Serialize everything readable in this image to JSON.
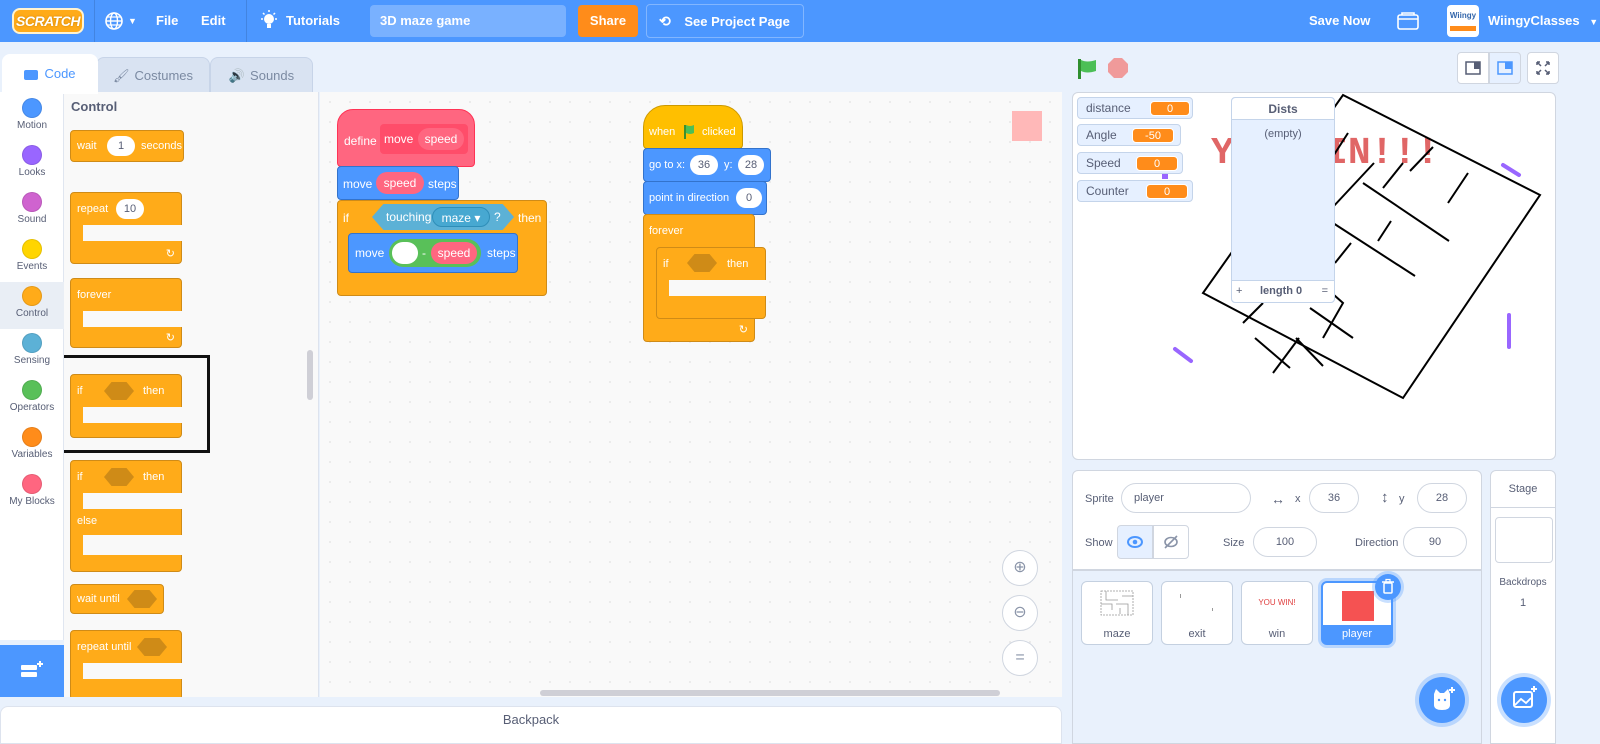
{
  "menubar": {
    "logo": "SCRATCH",
    "file": "File",
    "edit": "Edit",
    "tutorials": "Tutorials",
    "project_title": "3D maze game",
    "share": "Share",
    "see_project_page": "See Project Page",
    "save_now": "Save Now",
    "username": "WiingyClasses",
    "avatar_text": "Wiingy",
    "brand_color": "#4c97ff"
  },
  "tabs": [
    {
      "label": "Code",
      "active": true
    },
    {
      "label": "Costumes",
      "active": false
    },
    {
      "label": "Sounds",
      "active": false
    }
  ],
  "categories": [
    {
      "label": "Motion",
      "color": "#4c97ff"
    },
    {
      "label": "Looks",
      "color": "#9966ff"
    },
    {
      "label": "Sound",
      "color": "#cf63cf"
    },
    {
      "label": "Events",
      "color": "#ffd500"
    },
    {
      "label": "Control",
      "color": "#ffab19"
    },
    {
      "label": "Sensing",
      "color": "#5cb1d6"
    },
    {
      "label": "Operators",
      "color": "#59c059"
    },
    {
      "label": "Variables",
      "color": "#ff8c1a"
    },
    {
      "label": "My Blocks",
      "color": "#ff6680"
    }
  ],
  "palette": {
    "title": "Control",
    "blocks": {
      "wait": "wait",
      "wait_value": "1",
      "seconds": "seconds",
      "repeat": "repeat",
      "repeat_value": "10",
      "forever": "forever",
      "if": "if",
      "then": "then",
      "if2": "if",
      "then2": "then",
      "else": "else",
      "wait_until": "wait until",
      "repeat_until": "repeat until"
    }
  },
  "scripts": {
    "define": {
      "define": "define",
      "name": "move",
      "param": "speed",
      "move": "move",
      "move_param": "speed",
      "steps": "steps",
      "if": "if",
      "touching": "touching",
      "touching_target": "maze ▾",
      "question": "?",
      "then": "then",
      "move2": "move",
      "minus": "-",
      "speed2": "speed",
      "steps2": "steps"
    },
    "flag": {
      "when": "when",
      "clicked": "clicked",
      "goto": "go to x:",
      "x": "36",
      "y_label": "y:",
      "y": "28",
      "point": "point in direction",
      "direction": "0",
      "forever": "forever",
      "if": "if",
      "then": "then"
    }
  },
  "backpack": "Backpack",
  "stage": {
    "monitors": [
      {
        "label": "distance",
        "value": "0"
      },
      {
        "label": "Angle",
        "value": "-50"
      },
      {
        "label": "Speed",
        "value": "0"
      },
      {
        "label": "Counter",
        "value": "0"
      }
    ],
    "list": {
      "title": "Dists",
      "empty": "(empty)",
      "add": "+",
      "length": "length 0",
      "resize": "="
    },
    "win_text": "YOU WIN!!!"
  },
  "sprite_info": {
    "sprite_label": "Sprite",
    "sprite_name": "player",
    "x_label": "x",
    "x": "36",
    "y_label": "y",
    "y": "28",
    "show_label": "Show",
    "size_label": "Size",
    "size": "100",
    "direction_label": "Direction",
    "direction": "90"
  },
  "sprites": [
    {
      "name": "maze",
      "selected": false
    },
    {
      "name": "exit",
      "selected": false
    },
    {
      "name": "win",
      "selected": false,
      "thumb_text": "YOU WIN!"
    },
    {
      "name": "player",
      "selected": true
    }
  ],
  "stage_pane": {
    "title": "Stage",
    "backdrops_label": "Backdrops",
    "backdrops_count": "1"
  }
}
